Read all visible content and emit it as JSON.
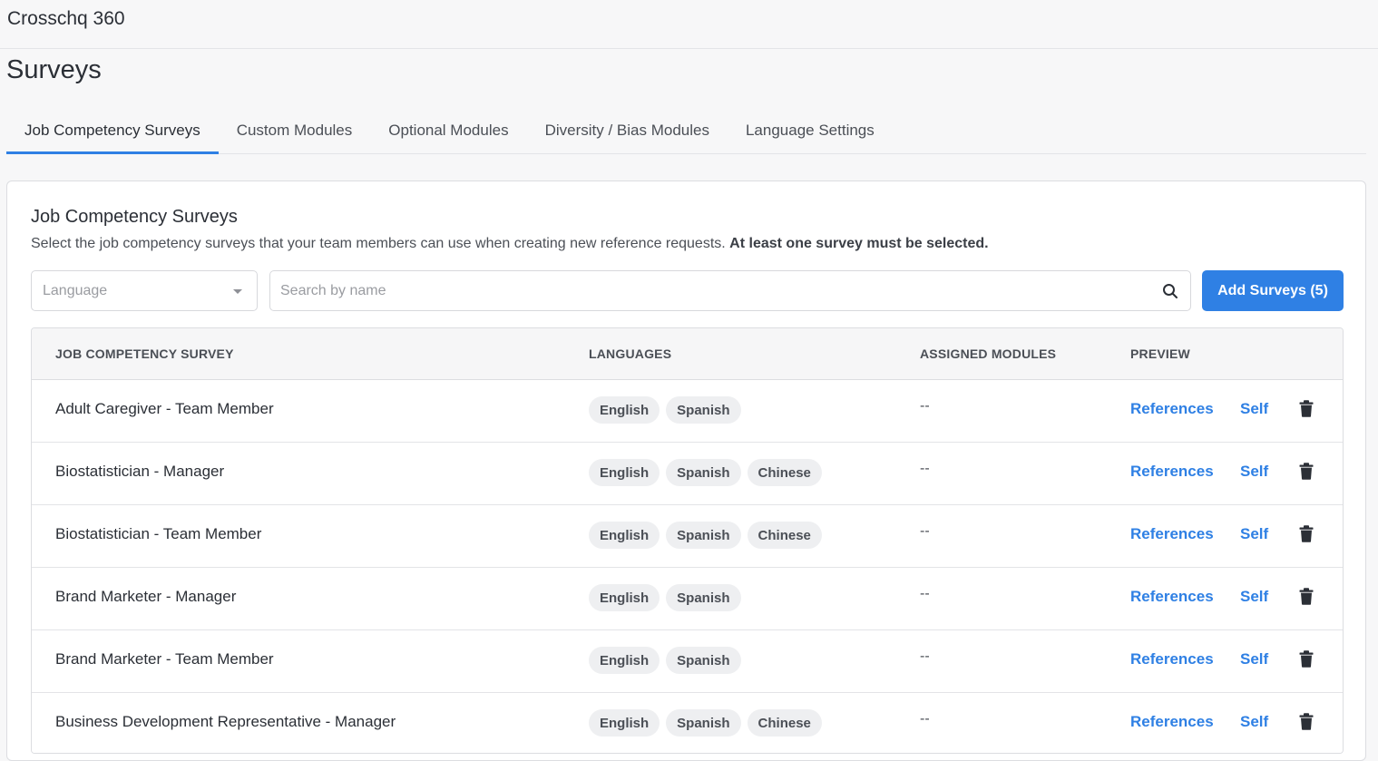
{
  "app": {
    "title": "Crosschq 360"
  },
  "page": {
    "title": "Surveys"
  },
  "tabs": [
    {
      "label": "Job Competency Surveys",
      "active": true
    },
    {
      "label": "Custom Modules",
      "active": false
    },
    {
      "label": "Optional Modules",
      "active": false
    },
    {
      "label": "Diversity / Bias Modules",
      "active": false
    },
    {
      "label": "Language Settings",
      "active": false
    }
  ],
  "card": {
    "title": "Job Competency Surveys",
    "description": "Select the job competency surveys that your team members can use when creating new reference requests.",
    "description_bold": "At least one survey must be selected."
  },
  "filters": {
    "language_placeholder": "Language",
    "search_placeholder": "Search by name",
    "search_value": "",
    "add_button_label": "Add Surveys (5)"
  },
  "table": {
    "headers": {
      "survey": "JOB COMPETENCY SURVEY",
      "languages": "LANGUAGES",
      "modules": "ASSIGNED MODULES",
      "preview": "PREVIEW"
    },
    "rows": [
      {
        "name": "Adult Caregiver - Team Member",
        "languages": [
          "English",
          "Spanish"
        ],
        "modules": "--",
        "ref_label": "References",
        "self_label": "Self"
      },
      {
        "name": "Biostatistician - Manager",
        "languages": [
          "English",
          "Spanish",
          "Chinese"
        ],
        "modules": "--",
        "ref_label": "References",
        "self_label": "Self"
      },
      {
        "name": "Biostatistician - Team Member",
        "languages": [
          "English",
          "Spanish",
          "Chinese"
        ],
        "modules": "--",
        "ref_label": "References",
        "self_label": "Self"
      },
      {
        "name": "Brand Marketer - Manager",
        "languages": [
          "English",
          "Spanish"
        ],
        "modules": "--",
        "ref_label": "References",
        "self_label": "Self"
      },
      {
        "name": "Brand Marketer - Team Member",
        "languages": [
          "English",
          "Spanish"
        ],
        "modules": "--",
        "ref_label": "References",
        "self_label": "Self"
      },
      {
        "name": "Business Development Representative - Manager",
        "languages": [
          "English",
          "Spanish",
          "Chinese"
        ],
        "modules": "--",
        "ref_label": "References",
        "self_label": "Self"
      }
    ]
  },
  "colors": {
    "accent": "#2f80e4",
    "chip_bg": "#eeeff1"
  },
  "icons": {
    "search": "search-icon",
    "trash": "trash-icon",
    "dropdown": "chevron-down-icon"
  }
}
